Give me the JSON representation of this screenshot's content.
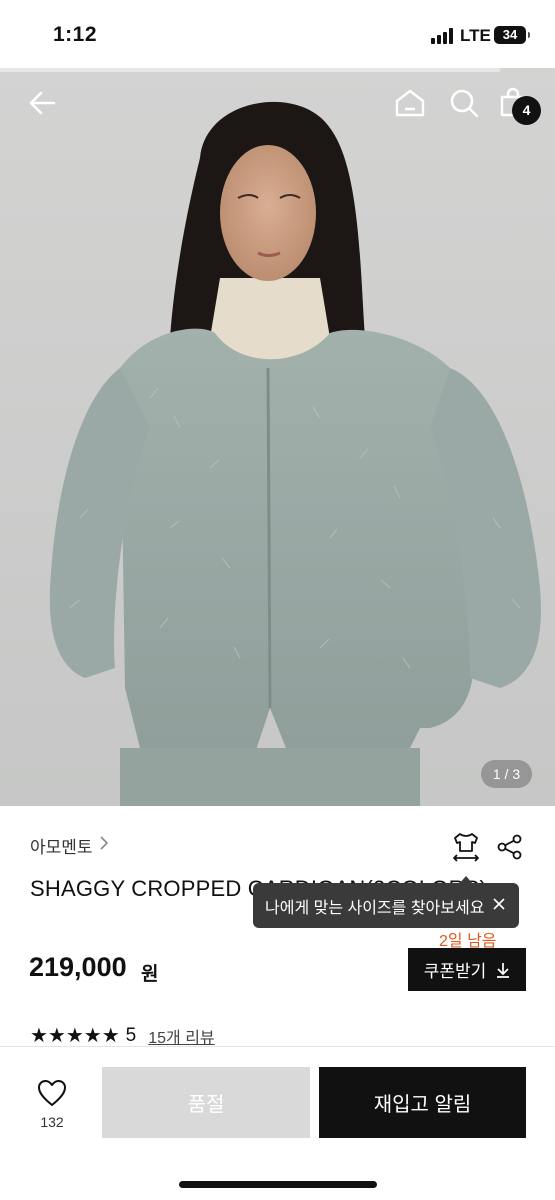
{
  "status_bar": {
    "time": "1:12",
    "network": "LTE",
    "battery": "34"
  },
  "hero": {
    "progress_fraction": 0.9,
    "cart_count": "4",
    "image_counter": "1 / 3"
  },
  "product": {
    "brand": "아모멘토",
    "name": "SHAGGY CROPPED CARDIGAN(2COLORS)",
    "size_tooltip": "나에게 맞는 사이즈를 찾아보세요",
    "days_left": "2일 남음",
    "price": "219,000",
    "price_unit": "원",
    "coupon_label": "쿠폰받기",
    "stars": "★★★★★",
    "rating": "5",
    "review_link": "15개 리뷰"
  },
  "bottom_bar": {
    "wish_count": "132",
    "soldout_label": "품절",
    "restock_label": "재입고 알림"
  },
  "colors": {
    "accent": "#e05a1e",
    "dark": "#111111",
    "disabled": "#d9d9d9"
  },
  "icons": [
    "back-arrow-icon",
    "home-icon",
    "search-icon",
    "shopping-bag-icon",
    "size-guide-icon",
    "share-icon",
    "close-icon",
    "download-icon",
    "heart-icon",
    "chevron-right-icon"
  ]
}
